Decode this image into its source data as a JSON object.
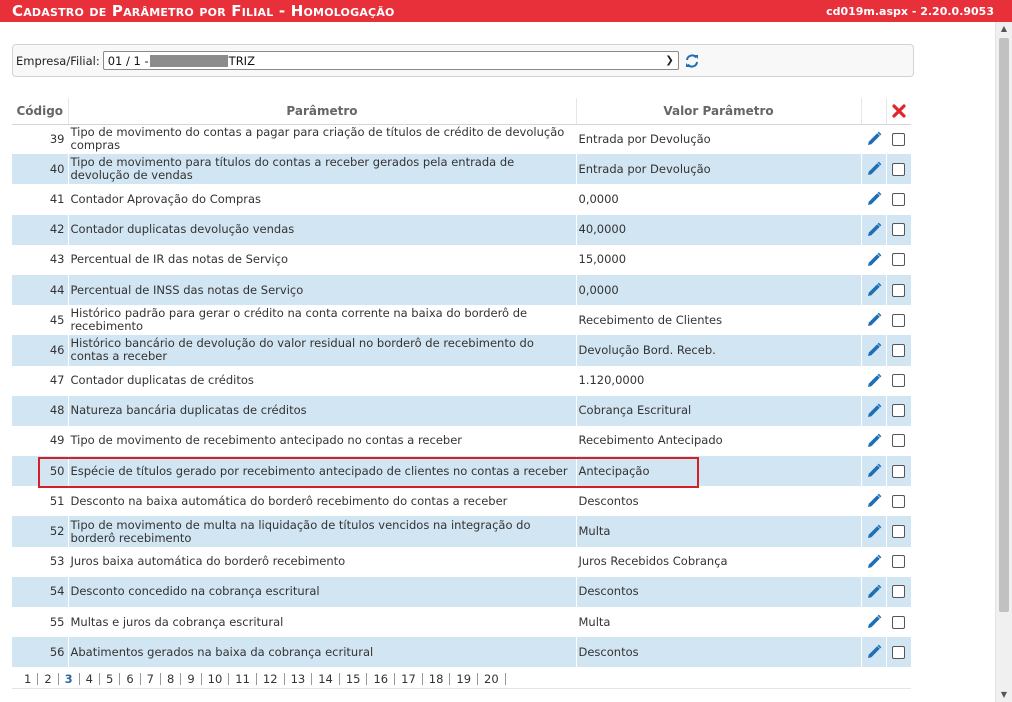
{
  "header": {
    "title": "Cadastro de Parâmetro por Filial  - Homologação",
    "version": "cd019m.aspx - 2.20.0.9053"
  },
  "filter": {
    "label": "Empresa/Filial:",
    "value_prefix": "01 / 1 -",
    "value_suffix": "TRIZ"
  },
  "table": {
    "headers": {
      "code": "Código",
      "param": "Parâmetro",
      "value": "Valor Parâmetro"
    },
    "rows": [
      {
        "code": "39",
        "param": "Tipo de movimento do contas a pagar para criação de títulos de crédito de devolução compras",
        "value": "Entrada por Devolução"
      },
      {
        "code": "40",
        "param": "Tipo de movimento para títulos do contas a receber gerados pela entrada de devolução de vendas",
        "value": "Entrada por Devolução"
      },
      {
        "code": "41",
        "param": "Contador Aprovação do Compras",
        "value": "0,0000"
      },
      {
        "code": "42",
        "param": "Contador duplicatas devolução vendas",
        "value": "40,0000"
      },
      {
        "code": "43",
        "param": "Percentual de IR das notas de Serviço",
        "value": "15,0000"
      },
      {
        "code": "44",
        "param": "Percentual de INSS das notas de Serviço",
        "value": "0,0000"
      },
      {
        "code": "45",
        "param": "Histórico padrão para gerar o crédito na conta corrente na baixa do borderô de recebimento",
        "value": "Recebimento de Clientes"
      },
      {
        "code": "46",
        "param": "Histórico bancário de devolução do valor residual no borderô de recebimento do contas a receber",
        "value": "Devolução Bord. Receb."
      },
      {
        "code": "47",
        "param": "Contador duplicatas de créditos",
        "value": "1.120,0000"
      },
      {
        "code": "48",
        "param": "Natureza bancária duplicatas de créditos",
        "value": "Cobrança Escritural"
      },
      {
        "code": "49",
        "param": "Tipo de movimento de recebimento antecipado no contas a receber",
        "value": "Recebimento Antecipado"
      },
      {
        "code": "50",
        "param": "Espécie de títulos gerado por recebimento antecipado de clientes no contas a receber",
        "value": "Antecipação"
      },
      {
        "code": "51",
        "param": "Desconto na baixa automática do borderô recebimento do contas a receber",
        "value": "Descontos"
      },
      {
        "code": "52",
        "param": "Tipo de movimento de multa na liquidação de títulos vencidos na integração do borderô recebimento",
        "value": "Multa"
      },
      {
        "code": "53",
        "param": "Juros baixa automática do borderô recebimento",
        "value": "Juros Recebidos Cobrança"
      },
      {
        "code": "54",
        "param": "Desconto concedido na cobrança escritural",
        "value": "Descontos"
      },
      {
        "code": "55",
        "param": "Multas e juros da cobrança escritural",
        "value": "Multa"
      },
      {
        "code": "56",
        "param": "Abatimentos gerados na baixa da cobrança ecritural",
        "value": "Descontos"
      }
    ]
  },
  "pager": {
    "current": "3",
    "pages": [
      "1",
      "2",
      "3",
      "4",
      "5",
      "6",
      "7",
      "8",
      "9",
      "10",
      "11",
      "12",
      "13",
      "14",
      "15",
      "16",
      "17",
      "18",
      "19",
      "20"
    ]
  },
  "colors": {
    "title_bar": "#e8303a",
    "row_alt": "#d2e5f2",
    "icon_blue": "#1f6fb5",
    "highlight_red": "#d42027",
    "delete_red": "#e0262b"
  }
}
